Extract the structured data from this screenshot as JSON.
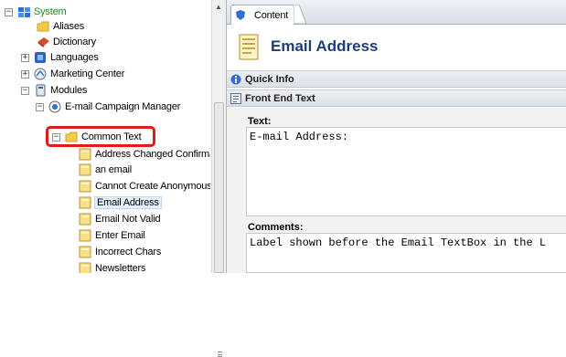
{
  "tree": {
    "nodes": [
      {
        "label": "System",
        "expander": "⊟",
        "icon": "system-icon"
      },
      {
        "label": "Aliases",
        "icon": "folder-icon"
      },
      {
        "label": "Dictionary",
        "icon": "dictionary-icon"
      },
      {
        "label": "Languages",
        "expander": "⊞",
        "icon": "language-icon"
      },
      {
        "label": "Marketing Center",
        "expander": "⊞",
        "icon": "marketing-icon"
      },
      {
        "label": "Modules",
        "expander": "⊟",
        "icon": "modules-icon"
      },
      {
        "label": "E-mail Campaign Manager",
        "expander": "⊟",
        "icon": "campaign-icon"
      },
      {
        "label": "Common Text",
        "expander": "⊟",
        "icon": "folder-icon"
      },
      {
        "label": "Address Changed Confirma",
        "icon": "item-icon"
      },
      {
        "label": "an email",
        "icon": "item-icon"
      },
      {
        "label": "Cannot Create Anonymous",
        "icon": "item-icon"
      },
      {
        "label": "Email Address",
        "icon": "item-icon",
        "selected": true
      },
      {
        "label": "Email Not Valid",
        "icon": "item-icon"
      },
      {
        "label": "Enter Email",
        "icon": "item-icon"
      },
      {
        "label": "Incorrect Chars",
        "icon": "item-icon"
      },
      {
        "label": "Newsletters",
        "icon": "item-icon"
      }
    ]
  },
  "content": {
    "tab_label": "Content",
    "title": "Email Address",
    "sections": {
      "quick_info": "Quick Info",
      "front_end_text": "Front End Text"
    },
    "fields": {
      "text_label": "Text:",
      "text_value": "E-mail Address:",
      "comments_label": "Comments:",
      "comments_value": "Label shown before the Email TextBox in the L"
    }
  },
  "colors": {
    "accent_title": "#1b3f7a",
    "highlight": "#e01b1b",
    "system_green": "#1c8a1c"
  }
}
